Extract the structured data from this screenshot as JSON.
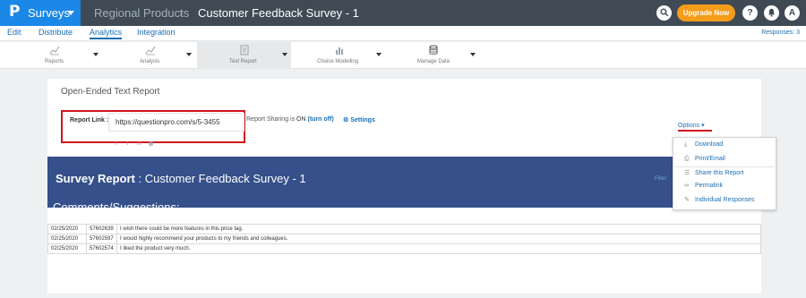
{
  "topbar": {
    "logo": "P",
    "product": "Surveys",
    "breadcrumb_1": "Regional Products",
    "breadcrumb_sep": "›",
    "breadcrumb_2": "Customer Feedback Survey - 1",
    "upgrade_label": "Upgrade Now",
    "help_label": "?",
    "avatar_label": "A"
  },
  "nav": {
    "items": [
      "Edit",
      "Distribute",
      "Analytics",
      "Integration"
    ],
    "active": "Analytics",
    "responses": "Responses: 3"
  },
  "toolbar": {
    "items": [
      {
        "label": "Reports",
        "icon": "line-chart-icon"
      },
      {
        "label": "Analysis",
        "icon": "line-chart-icon"
      },
      {
        "label": "Text Report",
        "icon": "document-icon"
      },
      {
        "label": "Choice Modelling",
        "icon": "bar-chart-icon"
      },
      {
        "label": "Manage Data",
        "icon": "database-icon"
      }
    ],
    "selected": "Text Report"
  },
  "card": {
    "title": "Open-Ended Text Report",
    "report_link_label": "Report Link :",
    "report_link_url": "https://questionpro.com/s/5-3455",
    "sharing_text": "Report Sharing is",
    "sharing_state": "ON",
    "turn_off": "(turn off)",
    "settings": "Settings",
    "options": "Options"
  },
  "report": {
    "title_bold": "Survey Report",
    "title_rest": " : Customer Feedback Survey - 1",
    "filter_label": "Filter",
    "section": "Comments/Suggestions:",
    "rows": [
      {
        "date": "02/25/2020",
        "id": "57602639",
        "comment": "I wish there could be more features in this price tag."
      },
      {
        "date": "02/25/2020",
        "id": "57602597",
        "comment": "I would highly recommend your products to my friends and colleagues."
      },
      {
        "date": "02/25/2020",
        "id": "57602574",
        "comment": "I liked the product very much."
      }
    ]
  },
  "options_menu": {
    "items": [
      {
        "label": "Download",
        "icon": "download-icon"
      },
      {
        "label": "Print/Email",
        "icon": "print-icon"
      },
      {
        "label": "Share this Report",
        "icon": "share-list-icon"
      },
      {
        "label": "Permalink",
        "icon": "link-icon"
      },
      {
        "label": "Individual Responses",
        "icon": "edit-icon"
      }
    ]
  },
  "colors": {
    "topbar": "#3f4a55",
    "brand_blue": "#1b87e6",
    "upgrade": "#f59c1a",
    "report_banner": "#35508a",
    "highlight_red": "#d0141e",
    "link_blue": "#1b6fb5"
  }
}
